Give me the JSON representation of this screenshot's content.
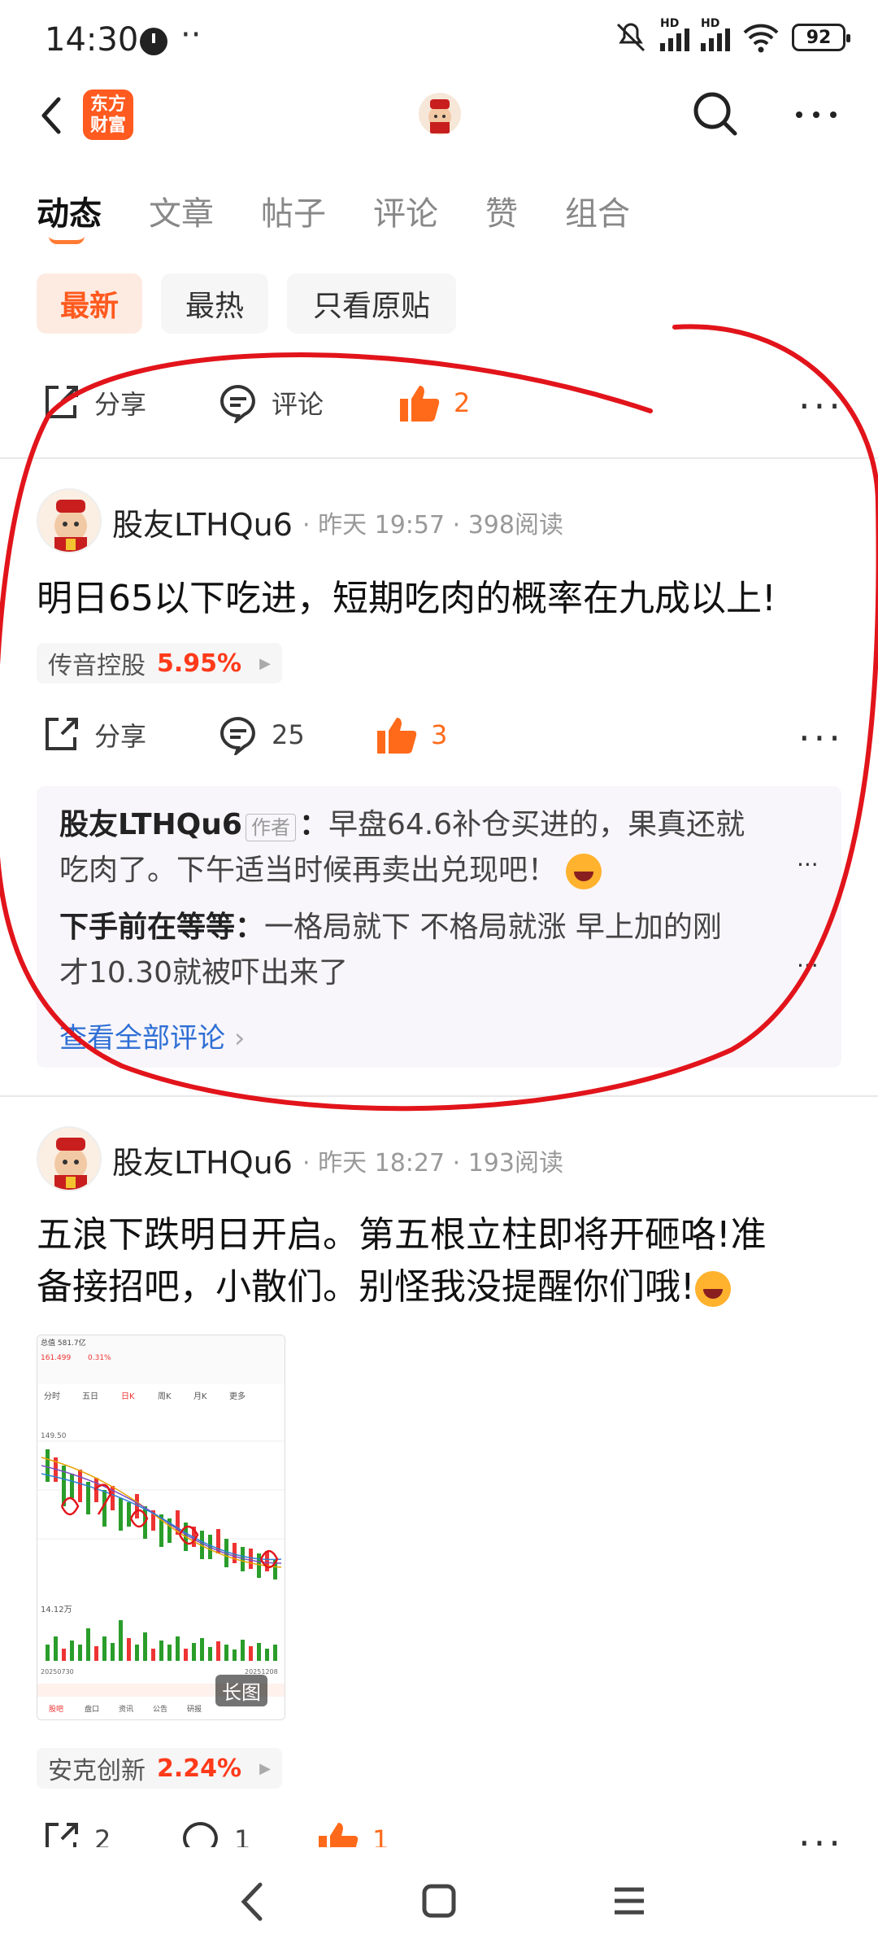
{
  "status_bar": {
    "time": "14:30",
    "battery": "92"
  },
  "header": {
    "logo_text": "东方财富"
  },
  "tabs": [
    "动态",
    "文章",
    "帖子",
    "评论",
    "赞",
    "组合"
  ],
  "filters": [
    "最新",
    "最热",
    "只看原贴"
  ],
  "top_actions": {
    "share": "分享",
    "comment": "评论",
    "likes": "2"
  },
  "post1": {
    "user": "股友LTHQu6",
    "time": "昨天 19:57",
    "reads": "398阅读",
    "text": "明日65以下吃进，短期吃肉的概率在九成以上!",
    "stock_name": "传音控股",
    "stock_change": "5.95%",
    "share": "分享",
    "comments": "25",
    "likes": "3",
    "comment1_user": "股友LTHQu6",
    "comment1_tag": "作者",
    "comment1_text_a": "早盘64.6补仓买进的，果真还就",
    "comment1_text_b": "吃肉了。下午适当时候再卖出兑现吧！",
    "comment2_user": "下手前在等等：",
    "comment2_text_a": "一格局就下 不格局就涨 早上加的刚",
    "comment2_text_b": "才10.30就被吓出来了",
    "view_all": "查看全部评论"
  },
  "post2": {
    "user": "股友LTHQu6",
    "time": "昨天 18:27",
    "reads": "193阅读",
    "text_a": "五浪下跌明日开启。第五根立柱即将开砸咯!准",
    "text_b": "备接招吧，小散们。别怪我没提醒你们哦!",
    "long_image": "长图",
    "stock_name": "安克创新",
    "stock_change": "2.24%",
    "shares": "2",
    "comments": "1",
    "likes": "1"
  },
  "chart_image": {
    "market_cap": "总值 581.7亿",
    "price": "161.499",
    "change": "0.31%",
    "tabs": [
      "分时",
      "五日",
      "日K",
      "周K",
      "月K",
      "更多"
    ],
    "y_top": "149.50",
    "date_start": "20250730",
    "date_end": "20251208",
    "vol": "14.12万",
    "bottom_tabs": [
      "股吧",
      "盘口",
      "资讯",
      "公告",
      "研报"
    ]
  },
  "colors": {
    "accent": "#ff5a1f",
    "up": "#ff3a1a",
    "link": "#2f6fd6",
    "annotation": "#e2141b"
  }
}
